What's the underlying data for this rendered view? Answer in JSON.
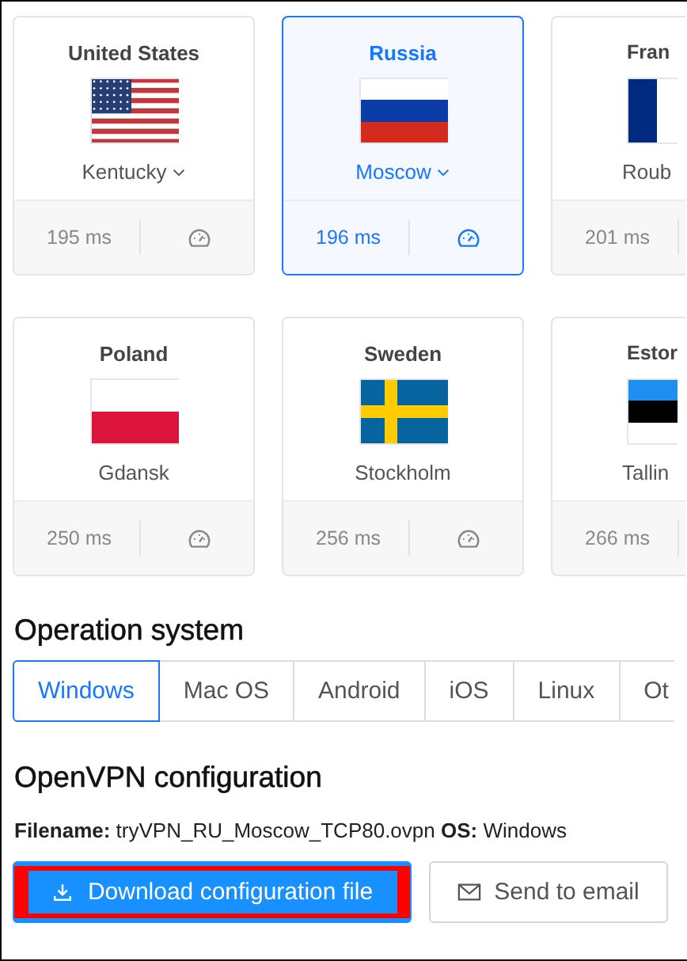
{
  "servers": [
    {
      "kind": "full",
      "country": "United States",
      "flag": {
        "kind": "us"
      },
      "city": "Kentucky",
      "dropdown": true,
      "ping": "195 ms",
      "selected": false
    },
    {
      "kind": "full",
      "country": "Russia",
      "flag": {
        "kind": "ru"
      },
      "city": "Moscow",
      "dropdown": true,
      "ping": "196 ms",
      "selected": true
    },
    {
      "kind": "partial",
      "country": "Fran",
      "flag": {
        "kind": "fr"
      },
      "city": "Roub",
      "dropdown": false,
      "ping": "201 ms",
      "selected": false
    },
    {
      "kind": "full",
      "country": "Poland",
      "flag": {
        "kind": "pl"
      },
      "city": "Gdansk",
      "dropdown": false,
      "ping": "250 ms",
      "selected": false
    },
    {
      "kind": "full",
      "country": "Sweden",
      "flag": {
        "kind": "se"
      },
      "city": "Stockholm",
      "dropdown": false,
      "ping": "256 ms",
      "selected": false
    },
    {
      "kind": "partial",
      "country": "Estor",
      "flag": {
        "kind": "ee"
      },
      "city": "Tallin",
      "dropdown": false,
      "ping": "266 ms",
      "selected": false
    }
  ],
  "os_section": {
    "title": "Operation system",
    "tabs": [
      {
        "label": "Windows",
        "selected": true
      },
      {
        "label": "Mac OS",
        "selected": false
      },
      {
        "label": "Android",
        "selected": false
      },
      {
        "label": "iOS",
        "selected": false
      },
      {
        "label": "Linux",
        "selected": false
      },
      {
        "label": "Ot",
        "selected": false
      }
    ]
  },
  "config": {
    "title": "OpenVPN configuration",
    "info": "**Filename:** tryVPN_RU_Moscow_TCP80.ovpn **OS:** Windows",
    "download_button": {
      "label": "Download configuration file",
      "highlighted": true
    },
    "email_button": {
      "label": "Send to email"
    }
  }
}
